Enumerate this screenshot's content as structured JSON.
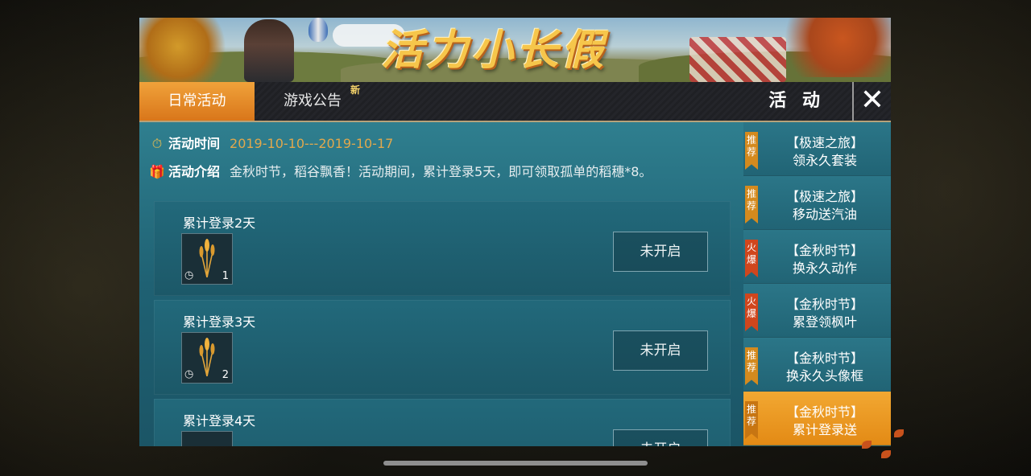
{
  "banner": {
    "title": "活力小长假"
  },
  "tabs": {
    "daily": "日常活动",
    "notice": "游戏公告",
    "notice_badge": "新",
    "header_title": "活 动",
    "close": "✕"
  },
  "activity": {
    "time_label": "活动时间",
    "time_value": "2019-10-10---2019-10-17",
    "intro_label": "活动介绍",
    "intro_value": "金秋时节，稻谷飘香！活动期间，累计登录5天，即可领取孤单的稻穗*8。"
  },
  "cards": [
    {
      "title": "累计登录2天",
      "qty": "1",
      "status": "未开启"
    },
    {
      "title": "累计登录3天",
      "qty": "2",
      "status": "未开启"
    },
    {
      "title": "累计登录4天",
      "qty": "",
      "status": "未开启"
    }
  ],
  "sidebar": [
    {
      "flag": "推荐",
      "line1": "【极速之旅】",
      "line2": "领永久套装"
    },
    {
      "flag": "推荐",
      "line1": "【极速之旅】",
      "line2": "移动送汽油"
    },
    {
      "flag": "火爆",
      "line1": "【金秋时节】",
      "line2": "换永久动作"
    },
    {
      "flag": "火爆",
      "line1": "【金秋时节】",
      "line2": "累登领枫叶"
    },
    {
      "flag": "推荐",
      "line1": "【金秋时节】",
      "line2": "换永久头像框"
    },
    {
      "flag": "推荐",
      "line1": "【金秋时节】",
      "line2": "累计登录送"
    }
  ],
  "colors": {
    "accent_orange": "#e38a15",
    "teal": "#216475",
    "date_gold": "#e0a84d"
  }
}
